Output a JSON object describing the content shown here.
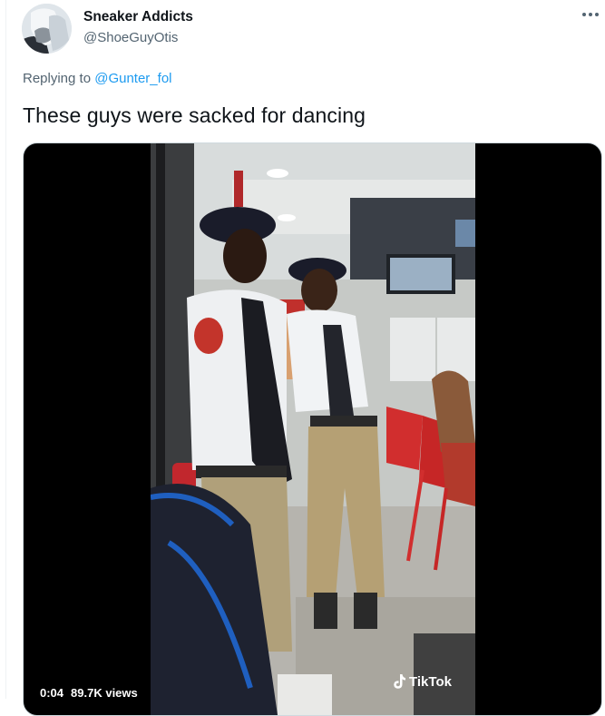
{
  "author": {
    "name": "Sneaker Addicts",
    "handle": "@ShoeGuyOtis"
  },
  "reply": {
    "prefix": "Replying to",
    "mention": "@Gunter_fol"
  },
  "tweet": {
    "text": "These guys were sacked for dancing"
  },
  "video": {
    "time": "0:04",
    "views": "89.7K views",
    "watermark": "TikTok"
  },
  "icons": {
    "more": "more-dots-icon",
    "tiktok": "tiktok-note-icon"
  },
  "colors": {
    "link": "#1d9bf0",
    "secondary_text": "#536471",
    "primary_text": "#0f1419",
    "border": "#cfd9de"
  }
}
